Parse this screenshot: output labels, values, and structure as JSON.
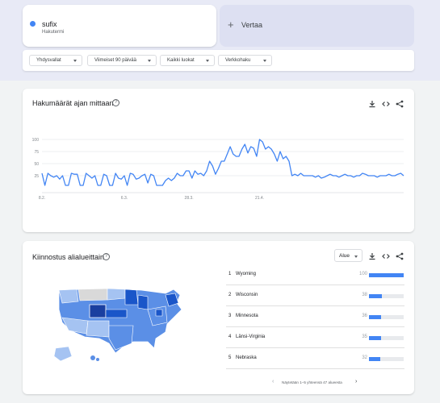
{
  "term": {
    "name": "sufix",
    "subtitle": "Hakutermi",
    "color": "#4285f4"
  },
  "compare": {
    "icon": "plus-icon",
    "label": "Vertaa"
  },
  "filters": [
    {
      "label": "Yhdysvallat"
    },
    {
      "label": "Viimeiset 90 päivää"
    },
    {
      "label": "Kaikki luokat"
    },
    {
      "label": "Verkkohaku"
    }
  ],
  "interest_over_time": {
    "title": "Hakumäärät ajan mittaan",
    "help": "?",
    "actions": [
      "download-icon",
      "embed-icon",
      "share-icon"
    ]
  },
  "chart_data": {
    "type": "line",
    "ylim": [
      0,
      100
    ],
    "yticks": [
      "100",
      "75",
      "50",
      "25"
    ],
    "xticks": [
      {
        "label": "8.2.",
        "index": 0
      },
      {
        "label": "6.3.",
        "index": 28
      },
      {
        "label": "28.3.",
        "index": 50
      },
      {
        "label": "21.4.",
        "index": 74
      }
    ],
    "grid": true,
    "series": [
      {
        "color": "#4285f4",
        "values": [
          30,
          5,
          30,
          25,
          22,
          25,
          18,
          25,
          5,
          5,
          30,
          28,
          28,
          5,
          5,
          30,
          25,
          20,
          25,
          5,
          5,
          28,
          25,
          5,
          5,
          30,
          20,
          18,
          25,
          5,
          30,
          28,
          18,
          20,
          25,
          28,
          10,
          28,
          25,
          5,
          5,
          5,
          15,
          20,
          15,
          20,
          30,
          25,
          25,
          35,
          35,
          20,
          35,
          28,
          30,
          25,
          35,
          55,
          45,
          28,
          40,
          55,
          55,
          70,
          85,
          70,
          65,
          65,
          80,
          90,
          72,
          85,
          82,
          65,
          100,
          95,
          80,
          85,
          80,
          70,
          55,
          75,
          60,
          65,
          55,
          25,
          28,
          25,
          30,
          25,
          25,
          25,
          25,
          22,
          25,
          20,
          22,
          25,
          28,
          25,
          25,
          22,
          25,
          28,
          25,
          25,
          22,
          25,
          25,
          30,
          28,
          25,
          25,
          25,
          22,
          25,
          25,
          25,
          28,
          25,
          25,
          28,
          30,
          25
        ]
      }
    ]
  },
  "subregion": {
    "title": "Kiinnostus alialueittain",
    "help": "?",
    "dropdown_label": "Alue",
    "actions": [
      "download-icon",
      "embed-icon",
      "share-icon"
    ],
    "rows": [
      {
        "rank": "1",
        "name": "Wyoming",
        "value": "100",
        "fill": 1.0
      },
      {
        "rank": "2",
        "name": "Wisconsin",
        "value": "38",
        "fill": 0.38
      },
      {
        "rank": "3",
        "name": "Minnesota",
        "value": "36",
        "fill": 0.36
      },
      {
        "rank": "4",
        "name": "Länsi-Virginia",
        "value": "35",
        "fill": 0.35
      },
      {
        "rank": "5",
        "name": "Nebraska",
        "value": "32",
        "fill": 0.32
      }
    ],
    "pager": "Näytetään 1–5 yhteensä 47 alueesta",
    "map_colors": {
      "high": "#1a56c9",
      "mid": "#5b8fe6",
      "low": "#a5c3f2",
      "none": "#d9d9d9"
    }
  }
}
